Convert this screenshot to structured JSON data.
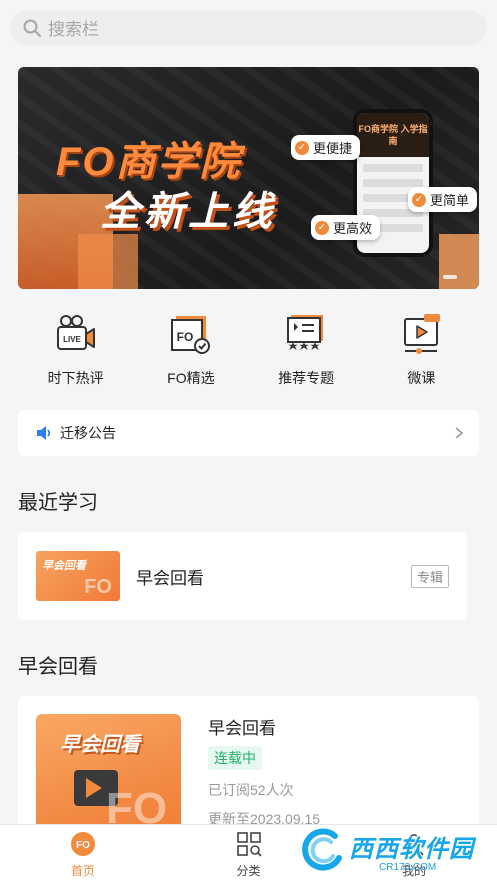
{
  "search": {
    "placeholder": "搜索栏"
  },
  "banner": {
    "title_line1": "FO商学院",
    "title_line2": "全新上线",
    "phone_header": "FO商学院 入学指南",
    "tags": [
      "更便捷",
      "更简单",
      "更高效"
    ]
  },
  "quick_entries": [
    {
      "label": "时下热评",
      "icon": "live-camera-icon"
    },
    {
      "label": "FO精选",
      "icon": "fo-badge-icon"
    },
    {
      "label": "推荐专题",
      "icon": "star-board-icon"
    },
    {
      "label": "微课",
      "icon": "video-player-icon"
    }
  ],
  "notice": {
    "text": "迁移公告"
  },
  "recent": {
    "section_title": "最近学习",
    "item": {
      "thumb_text": "早会回看",
      "name": "早会回看",
      "badge": "专辑"
    }
  },
  "replay": {
    "section_title": "早会回看",
    "item": {
      "thumb_text": "早会回看",
      "title": "早会回看",
      "status": "连载中",
      "subscribed": "已订阅52人次",
      "updated": "更新至2023.09.15"
    }
  },
  "tabbar": {
    "tabs": [
      {
        "label": "首页",
        "active": true
      },
      {
        "label": "分类",
        "active": false
      },
      {
        "label": "我的",
        "active": false
      }
    ]
  },
  "watermark": {
    "main": "西西软件园",
    "sub": "CR173.COM"
  },
  "colors": {
    "accent": "#f08a3c",
    "status_green": "#22b36a",
    "background": "#f5f5f7"
  }
}
